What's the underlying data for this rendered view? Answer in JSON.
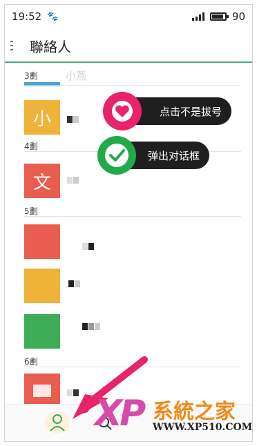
{
  "status_bar": {
    "time": "19:52",
    "battery_level": "90"
  },
  "header": {
    "title": "聯絡人"
  },
  "peek": {
    "name": "小燕"
  },
  "sections": [
    {
      "label": "3劃"
    },
    {
      "label": "4劃"
    },
    {
      "label": "5劃"
    },
    {
      "label": "6劃"
    }
  ],
  "contacts": [
    {
      "initial": "小",
      "color": "#f0b33a"
    },
    {
      "initial": "文",
      "color": "#e85d4f"
    }
  ],
  "callouts": {
    "tap": "点击不是拔号",
    "dialog": "弹出对话框"
  },
  "watermark": {
    "brand": "系統之家",
    "url": "WWW.XP510.COM",
    "logo": "XP"
  },
  "colors": {
    "accent": "#4caf7d",
    "heart": "#e8236a",
    "check": "#22a94a"
  }
}
